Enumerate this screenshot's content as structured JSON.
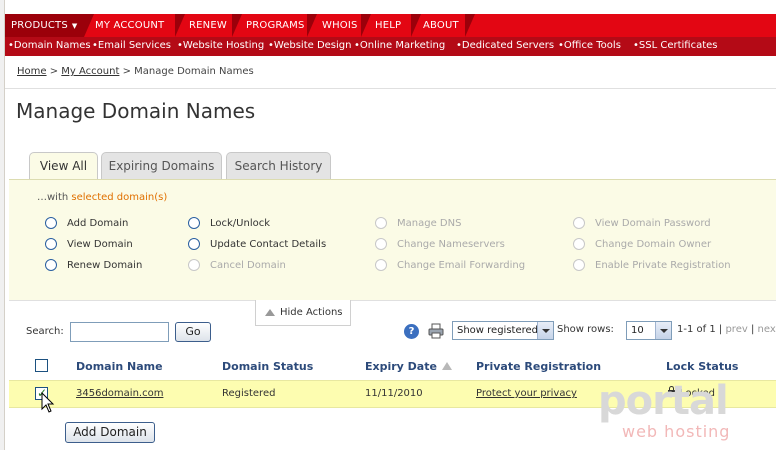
{
  "topnav": {
    "items": [
      "PRODUCTS",
      "MY ACCOUNT",
      "RENEW",
      "PROGRAMS",
      "WHOIS",
      "HELP",
      "ABOUT"
    ]
  },
  "subnav": {
    "items": [
      "•Domain Names",
      "•Email Services",
      "•Website Hosting",
      "•Website Design",
      "•Online Marketing",
      "•Dedicated Servers",
      "•Office Tools",
      "•SSL Certificates"
    ]
  },
  "breadcrumb": {
    "home": "Home",
    "sep1": ">",
    "account": "My Account",
    "sep2": ">",
    "current": "Manage Domain Names"
  },
  "page_title": "Manage Domain Names",
  "tabs": [
    "View All",
    "Expiring Domains",
    "Search History"
  ],
  "actions": {
    "with_prefix": "…with",
    "with_selected": "selected domain(s)",
    "col1": [
      "Add Domain",
      "View Domain",
      "Renew Domain"
    ],
    "col2": [
      "Lock/Unlock",
      "Update Contact Details",
      "Cancel Domain"
    ],
    "col3": [
      "Manage DNS",
      "Change Nameservers",
      "Change Email Forwarding"
    ],
    "col4": [
      "View Domain Password",
      "Change Domain Owner",
      "Enable Private Registration"
    ],
    "hide_label": "Hide Actions"
  },
  "search": {
    "label": "Search:",
    "value": "",
    "button": "Go"
  },
  "toolbar": {
    "filter_value": "Show registered",
    "rows_label": "Show rows:",
    "rows_value": "10",
    "range": "1-1 of 1",
    "sep": "|",
    "prev": "prev",
    "next": "nex"
  },
  "table": {
    "headers": [
      "Domain Name",
      "Domain Status",
      "Expiry Date",
      "Private Registration",
      "Lock Status"
    ],
    "rows": [
      {
        "domain": "3456domain.com",
        "status": "Registered",
        "expiry": "11/11/2010",
        "privacy": "Protect your privacy",
        "lock": "Locked"
      }
    ]
  },
  "add_domain_button": "Add Domain",
  "watermark": {
    "top": "portal",
    "bottom": "web hosting"
  },
  "colors": {
    "nav_red": "#e30613",
    "subnav_red": "#b40a16",
    "panel_yellow": "#fbfbe6",
    "row_highlight": "#fdfdb0",
    "header_blue": "#2c4a7a"
  }
}
